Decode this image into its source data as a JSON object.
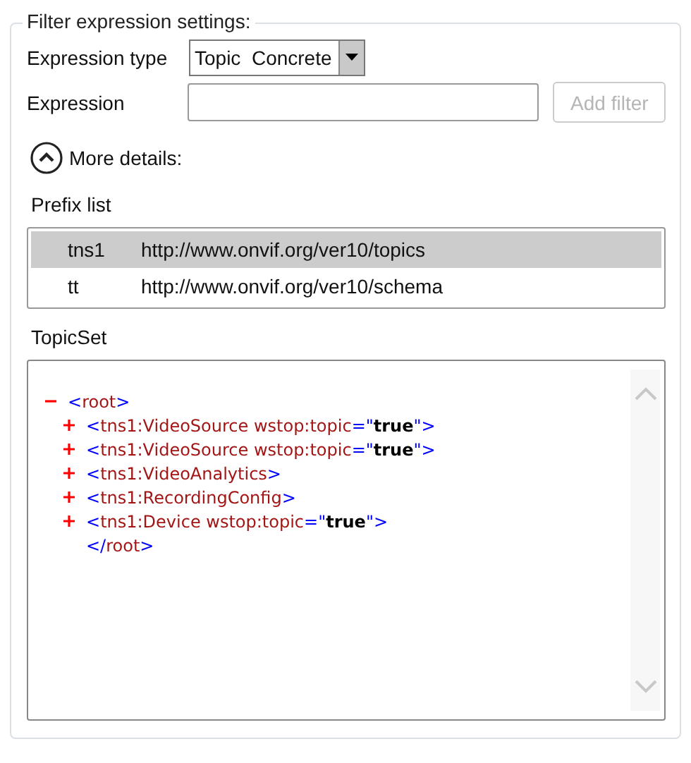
{
  "group": {
    "title": "Filter expression settings:"
  },
  "expression_type": {
    "label": "Expression type",
    "value": "Topic  Concrete"
  },
  "expression": {
    "label": "Expression"
  },
  "add_filter": {
    "label": "Add filter",
    "disabled": true
  },
  "more_details": {
    "label": "More details:",
    "expanded": true
  },
  "prefix_list": {
    "label": "Prefix list",
    "rows": [
      {
        "prefix": "tns1",
        "uri": "http://www.onvif.org/ver10/topics",
        "selected": true
      },
      {
        "prefix": "tt",
        "uri": "http://www.onvif.org/ver10/schema",
        "selected": false
      }
    ]
  },
  "topic_set": {
    "label": "TopicSet",
    "lines": [
      {
        "kind": "node",
        "expanded": true,
        "segments": [
          {
            "kind": "bracket",
            "text": "<"
          },
          {
            "kind": "name",
            "text": "root"
          },
          {
            "kind": "bracket",
            "text": ">"
          }
        ]
      },
      {
        "kind": "child",
        "expanded": false,
        "segments": [
          {
            "kind": "bracket",
            "text": "<"
          },
          {
            "kind": "name",
            "text": "tns1:VideoSource wstop:topic"
          },
          {
            "kind": "bracket",
            "text": "=\""
          },
          {
            "kind": "value",
            "text": "true"
          },
          {
            "kind": "bracket",
            "text": "\">"
          }
        ]
      },
      {
        "kind": "child",
        "expanded": false,
        "segments": [
          {
            "kind": "bracket",
            "text": "<"
          },
          {
            "kind": "name",
            "text": "tns1:VideoSource wstop:topic"
          },
          {
            "kind": "bracket",
            "text": "=\""
          },
          {
            "kind": "value",
            "text": "true"
          },
          {
            "kind": "bracket",
            "text": "\">"
          }
        ]
      },
      {
        "kind": "child",
        "expanded": false,
        "segments": [
          {
            "kind": "bracket",
            "text": "<"
          },
          {
            "kind": "name",
            "text": "tns1:VideoAnalytics"
          },
          {
            "kind": "bracket",
            "text": ">"
          }
        ]
      },
      {
        "kind": "child",
        "expanded": false,
        "segments": [
          {
            "kind": "bracket",
            "text": "<"
          },
          {
            "kind": "name",
            "text": "tns1:RecordingConfig"
          },
          {
            "kind": "bracket",
            "text": ">"
          }
        ]
      },
      {
        "kind": "child",
        "expanded": false,
        "segments": [
          {
            "kind": "bracket",
            "text": "<"
          },
          {
            "kind": "name",
            "text": "tns1:Device wstop:topic"
          },
          {
            "kind": "bracket",
            "text": "=\""
          },
          {
            "kind": "value",
            "text": "true"
          },
          {
            "kind": "bracket",
            "text": "\">"
          }
        ]
      },
      {
        "kind": "closing",
        "segments": [
          {
            "kind": "bracket",
            "text": "</"
          },
          {
            "kind": "name",
            "text": "root"
          },
          {
            "kind": "bracket",
            "text": ">"
          }
        ]
      }
    ]
  }
}
